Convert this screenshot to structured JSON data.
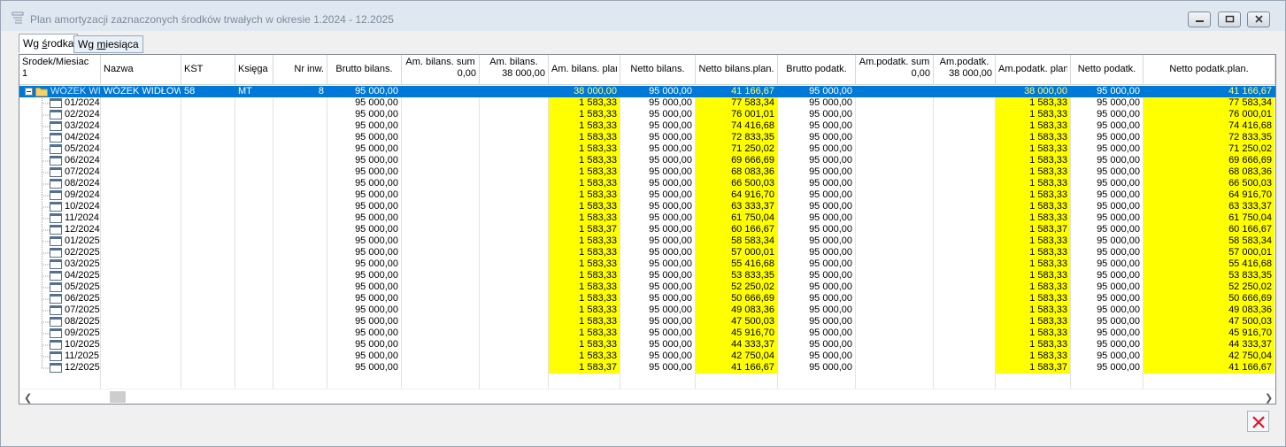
{
  "window": {
    "title": "Plan amortyzacji zaznaczonych środków trwałych w okresie 1.2024 - 12.2025"
  },
  "icons": {
    "app": "table-list-icon",
    "minimize": "minimize-icon",
    "maximize": "maximize-icon",
    "close": "close-icon",
    "folder": "folder-icon",
    "month": "calendar-row-icon",
    "cancel": "red-x-icon"
  },
  "tabs": [
    {
      "label": "Wg środka",
      "underline": "ś"
    },
    {
      "label": "Wg miesiąca",
      "underline": "m"
    }
  ],
  "columns": [
    {
      "line1": "Środek/Miesiac",
      "line2": "1"
    },
    {
      "line1": "Nazwa",
      "line2": ""
    },
    {
      "line1": "KŚT",
      "line2": ""
    },
    {
      "line1": "Księga",
      "line2": ""
    },
    {
      "line1": "Nr inw.",
      "line2": ""
    },
    {
      "line1": "Brutto bilans.",
      "line2": ""
    },
    {
      "line1": "Am. bilans. sum",
      "line2": "0,00"
    },
    {
      "line1": "Am. bilans.",
      "line2": "38 000,00"
    },
    {
      "line1": "Am. bilans. plan",
      "line2": ""
    },
    {
      "line1": "Netto bilans.",
      "line2": ""
    },
    {
      "line1": "Netto bilans.plan.",
      "line2": ""
    },
    {
      "line1": "Brutto podatk.",
      "line2": ""
    },
    {
      "line1": "Am.podatk. sum",
      "line2": "0,00"
    },
    {
      "line1": "Am.podatk.",
      "line2": "38 000,00"
    },
    {
      "line1": "Am.podatk. plan",
      "line2": ""
    },
    {
      "line1": "Netto podatk.",
      "line2": ""
    },
    {
      "line1": "Netto podatk.plan.",
      "line2": ""
    }
  ],
  "asset_row": {
    "tree": "WÓZEK WIDŁOWY",
    "nazwa": "WÓZEK WIDŁOWY",
    "kst": "58",
    "ksiega": "MT",
    "nr_inw": "8",
    "brutto_bilans": "95 000,00",
    "am_bilans_sum": "",
    "am_bilans": "",
    "am_bilans_plan": "38 000,00",
    "netto_bilans": "95 000,00",
    "netto_bilans_plan": "41 166,67",
    "brutto_podatk": "95 000,00",
    "am_podatk_sum": "",
    "am_podatk": "",
    "am_podatk_plan": "38 000,00",
    "netto_podatk": "95 000,00",
    "netto_podatk_plan": "41 166,67"
  },
  "month_rows": [
    {
      "month": "01/2024",
      "brutto_bilans": "95 000,00",
      "am_bilans_plan": "1 583,33",
      "netto_bilans": "95 000,00",
      "netto_bilans_plan": "77 583,34",
      "brutto_podatk": "95 000,00",
      "am_podatk_plan": "1 583,33",
      "netto_podatk": "95 000,00",
      "netto_podatk_plan": "77 583,34"
    },
    {
      "month": "02/2024",
      "brutto_bilans": "95 000,00",
      "am_bilans_plan": "1 583,33",
      "netto_bilans": "95 000,00",
      "netto_bilans_plan": "76 001,01",
      "brutto_podatk": "95 000,00",
      "am_podatk_plan": "1 583,33",
      "netto_podatk": "95 000,00",
      "netto_podatk_plan": "76 000,01"
    },
    {
      "month": "03/2024",
      "brutto_bilans": "95 000,00",
      "am_bilans_plan": "1 583,33",
      "netto_bilans": "95 000,00",
      "netto_bilans_plan": "74 416,68",
      "brutto_podatk": "95 000,00",
      "am_podatk_plan": "1 583,33",
      "netto_podatk": "95 000,00",
      "netto_podatk_plan": "74 416,68"
    },
    {
      "month": "04/2024",
      "brutto_bilans": "95 000,00",
      "am_bilans_plan": "1 583,33",
      "netto_bilans": "95 000,00",
      "netto_bilans_plan": "72 833,35",
      "brutto_podatk": "95 000,00",
      "am_podatk_plan": "1 583,33",
      "netto_podatk": "95 000,00",
      "netto_podatk_plan": "72 833,35"
    },
    {
      "month": "05/2024",
      "brutto_bilans": "95 000,00",
      "am_bilans_plan": "1 583,33",
      "netto_bilans": "95 000,00",
      "netto_bilans_plan": "71 250,02",
      "brutto_podatk": "95 000,00",
      "am_podatk_plan": "1 583,33",
      "netto_podatk": "95 000,00",
      "netto_podatk_plan": "71 250,02"
    },
    {
      "month": "06/2024",
      "brutto_bilans": "95 000,00",
      "am_bilans_plan": "1 583,33",
      "netto_bilans": "95 000,00",
      "netto_bilans_plan": "69 666,69",
      "brutto_podatk": "95 000,00",
      "am_podatk_plan": "1 583,33",
      "netto_podatk": "95 000,00",
      "netto_podatk_plan": "69 666,69"
    },
    {
      "month": "07/2024",
      "brutto_bilans": "95 000,00",
      "am_bilans_plan": "1 583,33",
      "netto_bilans": "95 000,00",
      "netto_bilans_plan": "68 083,36",
      "brutto_podatk": "95 000,00",
      "am_podatk_plan": "1 583,33",
      "netto_podatk": "95 000,00",
      "netto_podatk_plan": "68 083,36"
    },
    {
      "month": "08/2024",
      "brutto_bilans": "95 000,00",
      "am_bilans_plan": "1 583,33",
      "netto_bilans": "95 000,00",
      "netto_bilans_plan": "66 500,03",
      "brutto_podatk": "95 000,00",
      "am_podatk_plan": "1 583,33",
      "netto_podatk": "95 000,00",
      "netto_podatk_plan": "66 500,03"
    },
    {
      "month": "09/2024",
      "brutto_bilans": "95 000,00",
      "am_bilans_plan": "1 583,33",
      "netto_bilans": "95 000,00",
      "netto_bilans_plan": "64 916,70",
      "brutto_podatk": "95 000,00",
      "am_podatk_plan": "1 583,33",
      "netto_podatk": "95 000,00",
      "netto_podatk_plan": "64 916,70"
    },
    {
      "month": "10/2024",
      "brutto_bilans": "95 000,00",
      "am_bilans_plan": "1 583,33",
      "netto_bilans": "95 000,00",
      "netto_bilans_plan": "63 333,37",
      "brutto_podatk": "95 000,00",
      "am_podatk_plan": "1 583,33",
      "netto_podatk": "95 000,00",
      "netto_podatk_plan": "63 333,37"
    },
    {
      "month": "11/2024",
      "brutto_bilans": "95 000,00",
      "am_bilans_plan": "1 583,33",
      "netto_bilans": "95 000,00",
      "netto_bilans_plan": "61 750,04",
      "brutto_podatk": "95 000,00",
      "am_podatk_plan": "1 583,33",
      "netto_podatk": "95 000,00",
      "netto_podatk_plan": "61 750,04"
    },
    {
      "month": "12/2024",
      "brutto_bilans": "95 000,00",
      "am_bilans_plan": "1 583,37",
      "netto_bilans": "95 000,00",
      "netto_bilans_plan": "60 166,67",
      "brutto_podatk": "95 000,00",
      "am_podatk_plan": "1 583,37",
      "netto_podatk": "95 000,00",
      "netto_podatk_plan": "60 166,67"
    },
    {
      "month": "01/2025",
      "brutto_bilans": "95 000,00",
      "am_bilans_plan": "1 583,33",
      "netto_bilans": "95 000,00",
      "netto_bilans_plan": "58 583,34",
      "brutto_podatk": "95 000,00",
      "am_podatk_plan": "1 583,33",
      "netto_podatk": "95 000,00",
      "netto_podatk_plan": "58 583,34"
    },
    {
      "month": "02/2025",
      "brutto_bilans": "95 000,00",
      "am_bilans_plan": "1 583,33",
      "netto_bilans": "95 000,00",
      "netto_bilans_plan": "57 000,01",
      "brutto_podatk": "95 000,00",
      "am_podatk_plan": "1 583,33",
      "netto_podatk": "95 000,00",
      "netto_podatk_plan": "57 000,01"
    },
    {
      "month": "03/2025",
      "brutto_bilans": "95 000,00",
      "am_bilans_plan": "1 583,33",
      "netto_bilans": "95 000,00",
      "netto_bilans_plan": "55 416,68",
      "brutto_podatk": "95 000,00",
      "am_podatk_plan": "1 583,33",
      "netto_podatk": "95 000,00",
      "netto_podatk_plan": "55 416,68"
    },
    {
      "month": "04/2025",
      "brutto_bilans": "95 000,00",
      "am_bilans_plan": "1 583,33",
      "netto_bilans": "95 000,00",
      "netto_bilans_plan": "53 833,35",
      "brutto_podatk": "95 000,00",
      "am_podatk_plan": "1 583,33",
      "netto_podatk": "95 000,00",
      "netto_podatk_plan": "53 833,35"
    },
    {
      "month": "05/2025",
      "brutto_bilans": "95 000,00",
      "am_bilans_plan": "1 583,33",
      "netto_bilans": "95 000,00",
      "netto_bilans_plan": "52 250,02",
      "brutto_podatk": "95 000,00",
      "am_podatk_plan": "1 583,33",
      "netto_podatk": "95 000,00",
      "netto_podatk_plan": "52 250,02"
    },
    {
      "month": "06/2025",
      "brutto_bilans": "95 000,00",
      "am_bilans_plan": "1 583,33",
      "netto_bilans": "95 000,00",
      "netto_bilans_plan": "50 666,69",
      "brutto_podatk": "95 000,00",
      "am_podatk_plan": "1 583,33",
      "netto_podatk": "95 000,00",
      "netto_podatk_plan": "50 666,69"
    },
    {
      "month": "07/2025",
      "brutto_bilans": "95 000,00",
      "am_bilans_plan": "1 583,33",
      "netto_bilans": "95 000,00",
      "netto_bilans_plan": "49 083,36",
      "brutto_podatk": "95 000,00",
      "am_podatk_plan": "1 583,33",
      "netto_podatk": "95 000,00",
      "netto_podatk_plan": "49 083,36"
    },
    {
      "month": "08/2025",
      "brutto_bilans": "95 000,00",
      "am_bilans_plan": "1 583,33",
      "netto_bilans": "95 000,00",
      "netto_bilans_plan": "47 500,03",
      "brutto_podatk": "95 000,00",
      "am_podatk_plan": "1 583,33",
      "netto_podatk": "95 000,00",
      "netto_podatk_plan": "47 500,03"
    },
    {
      "month": "09/2025",
      "brutto_bilans": "95 000,00",
      "am_bilans_plan": "1 583,33",
      "netto_bilans": "95 000,00",
      "netto_bilans_plan": "45 916,70",
      "brutto_podatk": "95 000,00",
      "am_podatk_plan": "1 583,33",
      "netto_podatk": "95 000,00",
      "netto_podatk_plan": "45 916,70"
    },
    {
      "month": "10/2025",
      "brutto_bilans": "95 000,00",
      "am_bilans_plan": "1 583,33",
      "netto_bilans": "95 000,00",
      "netto_bilans_plan": "44 333,37",
      "brutto_podatk": "95 000,00",
      "am_podatk_plan": "1 583,33",
      "netto_podatk": "95 000,00",
      "netto_podatk_plan": "44 333,37"
    },
    {
      "month": "11/2025",
      "brutto_bilans": "95 000,00",
      "am_bilans_plan": "1 583,33",
      "netto_bilans": "95 000,00",
      "netto_bilans_plan": "42 750,04",
      "brutto_podatk": "95 000,00",
      "am_podatk_plan": "1 583,33",
      "netto_podatk": "95 000,00",
      "netto_podatk_plan": "42 750,04"
    },
    {
      "month": "12/2025",
      "brutto_bilans": "95 000,00",
      "am_bilans_plan": "1 583,37",
      "netto_bilans": "95 000,00",
      "netto_bilans_plan": "41 166,67",
      "brutto_podatk": "95 000,00",
      "am_podatk_plan": "1 583,37",
      "netto_podatk": "95 000,00",
      "netto_podatk_plan": "41 166,67"
    }
  ],
  "colors": {
    "selection": "#0078d7",
    "highlight": "#ffff00",
    "close_x": "#e81123"
  }
}
